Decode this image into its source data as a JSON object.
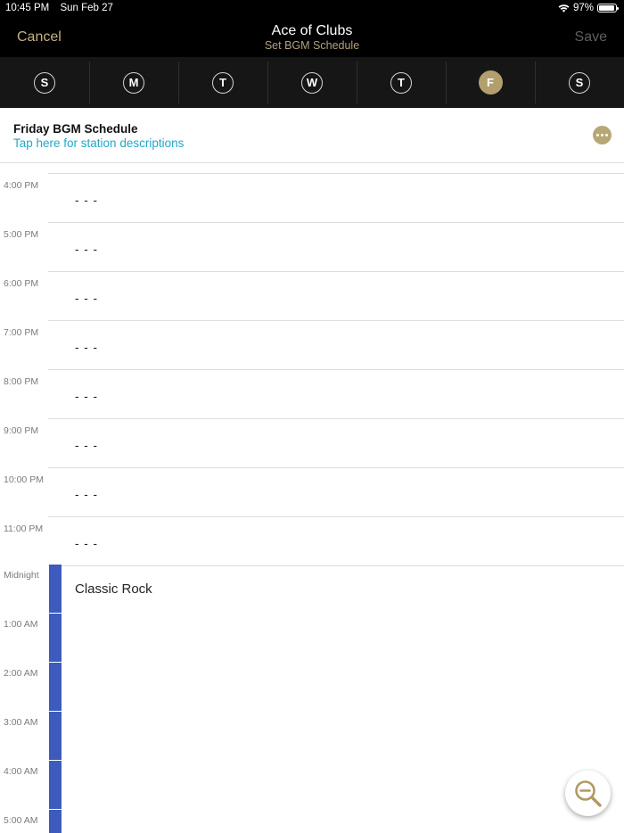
{
  "status_bar": {
    "time": "10:45 PM",
    "date": "Sun Feb 27",
    "battery": "97%",
    "wifi_icon": "wifi-icon",
    "battery_icon": "battery-icon"
  },
  "nav": {
    "cancel": "Cancel",
    "title": "Ace of Clubs",
    "subtitle": "Set BGM Schedule",
    "save": "Save"
  },
  "days": [
    {
      "letter": "S",
      "active": false
    },
    {
      "letter": "M",
      "active": false
    },
    {
      "letter": "T",
      "active": false
    },
    {
      "letter": "W",
      "active": false
    },
    {
      "letter": "T",
      "active": false
    },
    {
      "letter": "F",
      "active": true
    },
    {
      "letter": "S",
      "active": false
    }
  ],
  "schedule": {
    "title": "Friday BGM Schedule",
    "link": "Tap here for station descriptions",
    "more_icon": "more-icon"
  },
  "slots": [
    {
      "time": "4:00 PM",
      "value": "- - -"
    },
    {
      "time": "5:00 PM",
      "value": "- - -"
    },
    {
      "time": "6:00 PM",
      "value": "- - -"
    },
    {
      "time": "7:00 PM",
      "value": "- - -"
    },
    {
      "time": "8:00 PM",
      "value": "- - -"
    },
    {
      "time": "9:00 PM",
      "value": "- - -"
    },
    {
      "time": "10:00 PM",
      "value": "- - -"
    },
    {
      "time": "11:00 PM",
      "value": "- - -"
    },
    {
      "time": "Midnight",
      "value": ""
    },
    {
      "time": "1:00 AM",
      "value": ""
    },
    {
      "time": "2:00 AM",
      "value": ""
    },
    {
      "time": "3:00 AM",
      "value": ""
    },
    {
      "time": "4:00 AM",
      "value": ""
    },
    {
      "time": "5:00 AM",
      "value": ""
    }
  ],
  "station_block": {
    "label": "Classic Rock",
    "color": "#3c5bbd"
  },
  "zoom_button": {
    "icon": "zoom-out-icon"
  },
  "colors": {
    "accent": "#b39e6e",
    "link": "#23a7c9",
    "station": "#3c5bbd"
  }
}
